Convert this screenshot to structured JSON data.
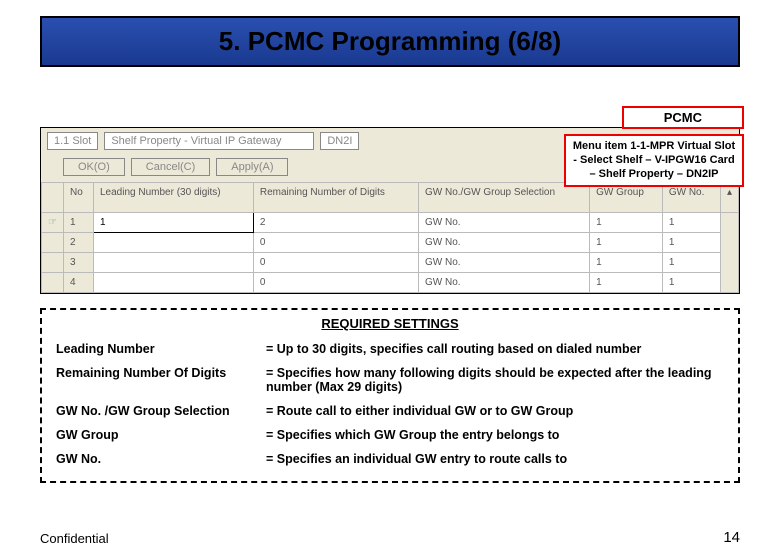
{
  "title": "5. PCMC Programming (6/8)",
  "pcmc_label": "PCMC",
  "callout": "Menu item 1-1-MPR Virtual Slot - Select Shelf – V-IPGW16 Card – Shelf Property – DN2IP",
  "screenshot": {
    "top": {
      "slot": "1.1 Slot",
      "prop": "Shelf Property - Virtual IP Gateway",
      "tab": "DN2I"
    },
    "buttons": {
      "ok": "OK(O)",
      "cancel": "Cancel(C)",
      "apply": "Apply(A)"
    },
    "headers": [
      "",
      "No",
      "Leading Number (30 digits)",
      "Remaining Number of Digits",
      "GW No./GW Group Selection",
      "GW Group",
      "GW No."
    ],
    "rows": [
      {
        "hand": "☞",
        "no": "1",
        "lead": "1",
        "rem": "2",
        "sel": "GW No.",
        "grp": "1",
        "gw": "1"
      },
      {
        "hand": "",
        "no": "2",
        "lead": "",
        "rem": "0",
        "sel": "GW No.",
        "grp": "1",
        "gw": "1"
      },
      {
        "hand": "",
        "no": "3",
        "lead": "",
        "rem": "0",
        "sel": "GW No.",
        "grp": "1",
        "gw": "1"
      },
      {
        "hand": "",
        "no": "4",
        "lead": "",
        "rem": "0",
        "sel": "GW No.",
        "grp": "1",
        "gw": "1"
      }
    ]
  },
  "settings": {
    "title": "REQUIRED SETTINGS",
    "rows": [
      {
        "k": "Leading Number",
        "v": "= Up to 30 digits, specifies call routing based on dialed number"
      },
      {
        "k": "Remaining Number Of Digits",
        "v": "= Specifies how many following digits should be expected after the leading number (Max 29 digits)"
      },
      {
        "k": "GW No. /GW Group Selection",
        "v": "= Route call to either individual GW or to GW Group"
      },
      {
        "k": "GW Group",
        "v": "= Specifies which GW Group the entry belongs to"
      },
      {
        "k": "GW No.",
        "v": "= Specifies an individual GW entry to route calls to"
      }
    ]
  },
  "footer": {
    "left": "Confidential",
    "right": "14"
  }
}
